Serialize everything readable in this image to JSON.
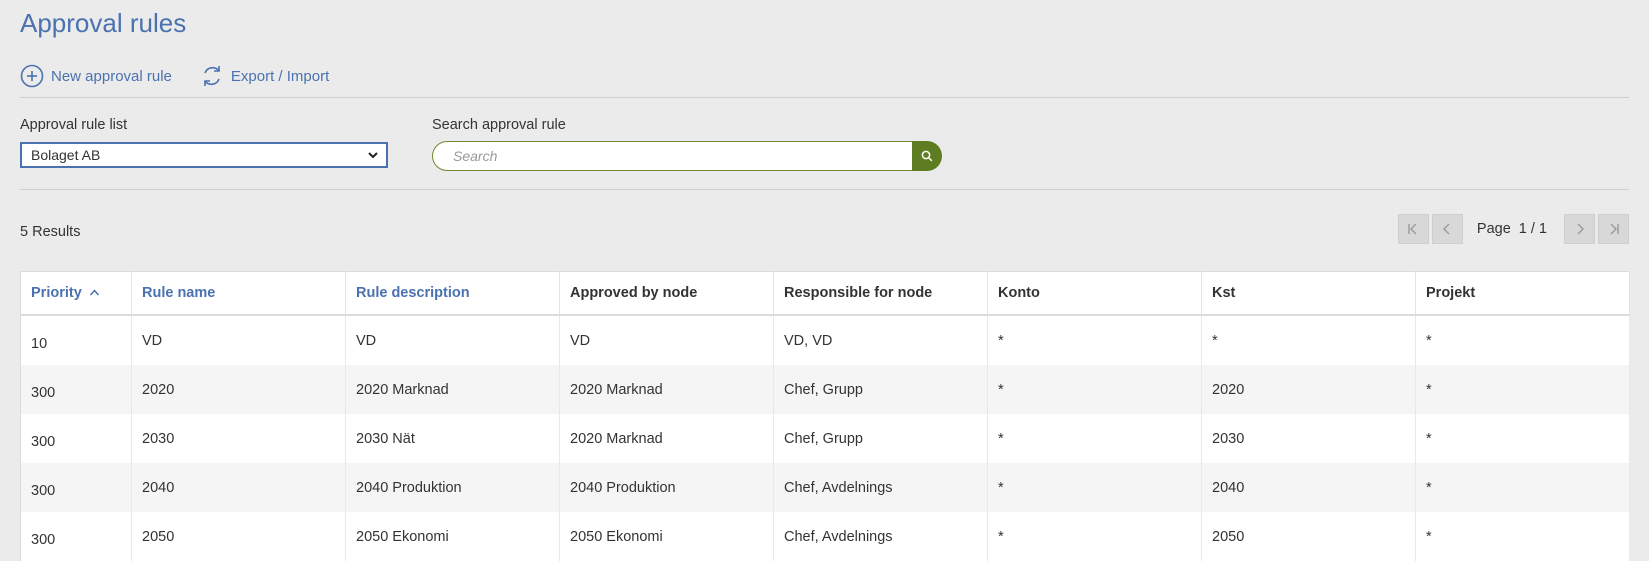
{
  "page": {
    "title": "Approval rules"
  },
  "toolbar": {
    "new_rule_label": "New approval rule",
    "export_import_label": "Export / Import"
  },
  "filters": {
    "list_label": "Approval rule list",
    "list_selected": "Bolaget AB",
    "search_label": "Search approval rule",
    "search_placeholder": "Search"
  },
  "results": {
    "count_text": "5 Results"
  },
  "pager": {
    "page_label": "Page",
    "page_value": "1 / 1"
  },
  "table": {
    "columns": [
      "Priority",
      "Rule name",
      "Rule description",
      "Approved by node",
      "Responsible for node",
      "Konto",
      "Kst",
      "Projekt"
    ],
    "rows": [
      [
        "10",
        "VD",
        "VD",
        "VD",
        "VD, VD",
        "*",
        "*",
        "*"
      ],
      [
        "300",
        "2020",
        "2020 Marknad",
        "2020 Marknad",
        "Chef, Grupp",
        "*",
        "2020",
        "*"
      ],
      [
        "300",
        "2030",
        "2030 Nät",
        "2020 Marknad",
        "Chef, Grupp",
        "*",
        "2030",
        "*"
      ],
      [
        "300",
        "2040",
        "2040 Produktion",
        "2040 Produktion",
        "Chef, Avdelnings",
        "*",
        "2040",
        "*"
      ],
      [
        "300",
        "2050",
        "2050 Ekonomi",
        "2050 Ekonomi",
        "Chef, Avdelnings",
        "*",
        "2050",
        "*"
      ]
    ]
  },
  "colors": {
    "accent_blue": "#4a72b0",
    "search_green": "#5e7d22",
    "background": "#ebebeb"
  }
}
